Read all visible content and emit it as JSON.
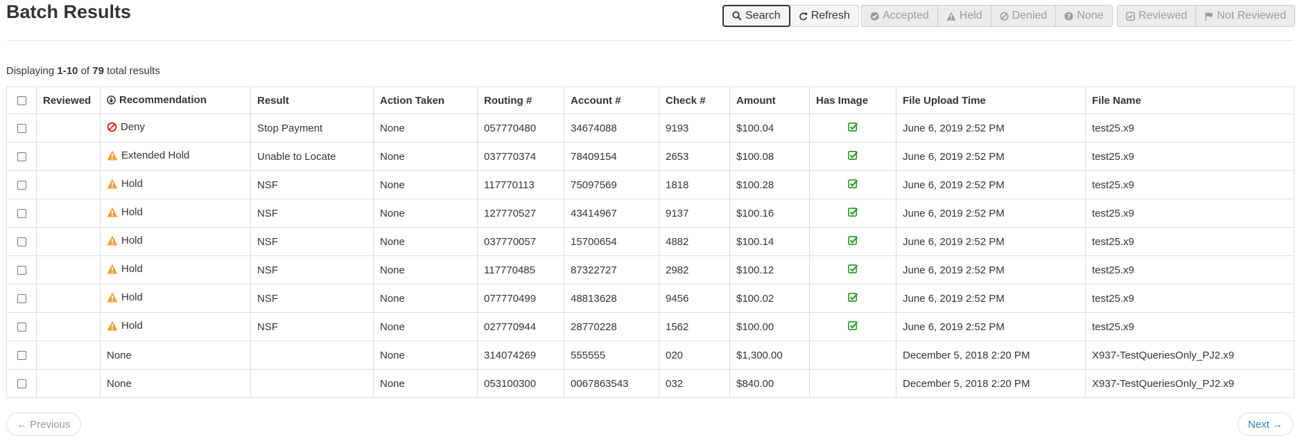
{
  "page_title": "Batch Results",
  "toolbar": {
    "search_label": "Search",
    "refresh_label": "Refresh",
    "filters": [
      {
        "label": "Accepted",
        "icon": "check-circle-icon"
      },
      {
        "label": "Held",
        "icon": "warning-icon"
      },
      {
        "label": "Denied",
        "icon": "ban-icon"
      },
      {
        "label": "None",
        "icon": "question-circle-icon"
      }
    ],
    "review_filters": [
      {
        "label": "Reviewed",
        "icon": "check-square-icon"
      },
      {
        "label": "Not Reviewed",
        "icon": "flag-icon"
      }
    ]
  },
  "summary": {
    "prefix": "Displaying ",
    "range": "1-10",
    "of": " of ",
    "total": "79",
    "suffix": " total results"
  },
  "table": {
    "headers": [
      "Reviewed",
      "Recommendation",
      "Result",
      "Action Taken",
      "Routing #",
      "Account #",
      "Check #",
      "Amount",
      "Has Image",
      "File Upload Time",
      "File Name"
    ],
    "rows": [
      {
        "rec": "Deny",
        "rec_icon": "deny",
        "result": "Stop Payment",
        "action": "None",
        "routing": "057770480",
        "account": "34674088",
        "check": "9193",
        "amount": "$100.04",
        "image": true,
        "time": "June 6, 2019 2:52 PM",
        "file": "test25.x9"
      },
      {
        "rec": "Extended Hold",
        "rec_icon": "warning",
        "result": "Unable to Locate",
        "action": "None",
        "routing": "037770374",
        "account": "78409154",
        "check": "2653",
        "amount": "$100.08",
        "image": true,
        "time": "June 6, 2019 2:52 PM",
        "file": "test25.x9"
      },
      {
        "rec": "Hold",
        "rec_icon": "warning",
        "result": "NSF",
        "action": "None",
        "routing": "117770113",
        "account": "75097569",
        "check": "1818",
        "amount": "$100.28",
        "image": true,
        "time": "June 6, 2019 2:52 PM",
        "file": "test25.x9"
      },
      {
        "rec": "Hold",
        "rec_icon": "warning",
        "result": "NSF",
        "action": "None",
        "routing": "127770527",
        "account": "43414967",
        "check": "9137",
        "amount": "$100.16",
        "image": true,
        "time": "June 6, 2019 2:52 PM",
        "file": "test25.x9"
      },
      {
        "rec": "Hold",
        "rec_icon": "warning",
        "result": "NSF",
        "action": "None",
        "routing": "037770057",
        "account": "15700654",
        "check": "4882",
        "amount": "$100.14",
        "image": true,
        "time": "June 6, 2019 2:52 PM",
        "file": "test25.x9"
      },
      {
        "rec": "Hold",
        "rec_icon": "warning",
        "result": "NSF",
        "action": "None",
        "routing": "117770485",
        "account": "87322727",
        "check": "2982",
        "amount": "$100.12",
        "image": true,
        "time": "June 6, 2019 2:52 PM",
        "file": "test25.x9"
      },
      {
        "rec": "Hold",
        "rec_icon": "warning",
        "result": "NSF",
        "action": "None",
        "routing": "077770499",
        "account": "48813628",
        "check": "9456",
        "amount": "$100.02",
        "image": true,
        "time": "June 6, 2019 2:52 PM",
        "file": "test25.x9"
      },
      {
        "rec": "Hold",
        "rec_icon": "warning",
        "result": "NSF",
        "action": "None",
        "routing": "027770944",
        "account": "28770228",
        "check": "1562",
        "amount": "$100.00",
        "image": true,
        "time": "June 6, 2019 2:52 PM",
        "file": "test25.x9"
      },
      {
        "rec": "None",
        "rec_icon": "",
        "result": "",
        "action": "None",
        "routing": "314074269",
        "account": "555555",
        "check": "020",
        "amount": "$1,300.00",
        "image": false,
        "time": "December 5, 2018 2:20 PM",
        "file": "X937-TestQueriesOnly_PJ2.x9"
      },
      {
        "rec": "None",
        "rec_icon": "",
        "result": "",
        "action": "None",
        "routing": "053100300",
        "account": "0067863543",
        "check": "032",
        "amount": "$840.00",
        "image": false,
        "time": "December 5, 2018 2:20 PM",
        "file": "X937-TestQueriesOnly_PJ2.x9"
      }
    ]
  },
  "pager": {
    "previous": "← Previous",
    "next": "Next →"
  },
  "colors": {
    "warning": "#f0a030",
    "deny": "#d9241b",
    "success": "#2e9a2e",
    "link": "#337ab7"
  }
}
